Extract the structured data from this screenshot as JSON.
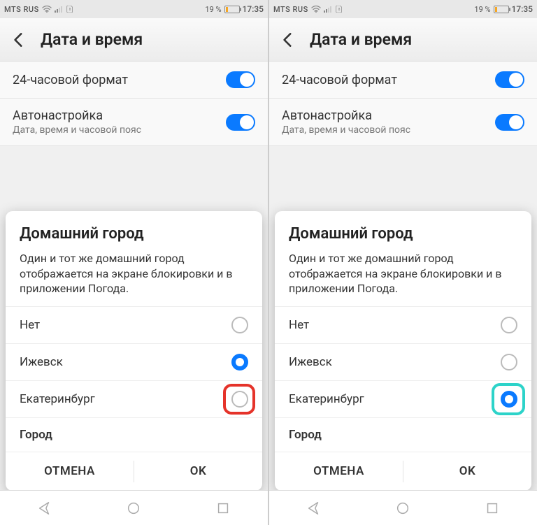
{
  "status": {
    "carrier": "MTS RUS",
    "battery_pct": "19 %",
    "time": "17:35"
  },
  "header": {
    "title": "Дата и время"
  },
  "settings": {
    "fmt24": {
      "label": "24-часовой формат"
    },
    "auto": {
      "label": "Автонастройка",
      "sub": "Дата, время и часовой пояс"
    }
  },
  "modal": {
    "title": "Домашний город",
    "desc": "Один и тот же домашний город отображается на экране блокировки и в приложении Погода.",
    "options": {
      "none": "Нет",
      "izh": "Ижевск",
      "ekb": "Екатеринбург",
      "city": "Город"
    },
    "cancel": "ОТМЕНА",
    "ok": "OK"
  }
}
